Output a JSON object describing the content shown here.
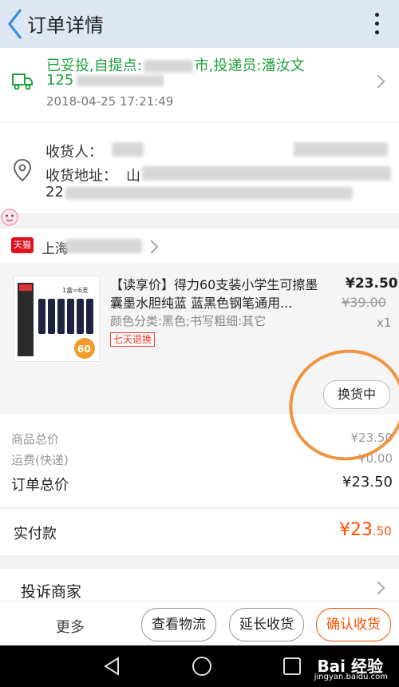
{
  "header": {
    "title": "订单详情"
  },
  "logistics": {
    "status_line1": "已妥投,自提点:",
    "status_line1_tail": "市,投递员:潘汝文",
    "status_line2": "125",
    "time": "2018-04-25 17:21:49"
  },
  "address": {
    "receiver_label": "收货人：",
    "address_label": "收货地址：",
    "address_start": "山",
    "postcode_start": "22"
  },
  "shop": {
    "badge": "天猫",
    "name_start": "上海"
  },
  "product": {
    "title": "【读享价】得力60支装小学生可擦墨囊墨水胆纯蓝 蓝黑色钢笔通用...",
    "spec": "颜色分类:黑色;书写粗细:其它",
    "return_tag": "七天退换",
    "price": "¥23.50",
    "original_price": "¥39.00",
    "quantity": "x1",
    "exchange_button": "换货中",
    "thumb_caption": "1盒=6支",
    "thumb_badge": "60",
    "thumb_count": "6支"
  },
  "totals": {
    "goods_label": "商品总价",
    "goods_value": "¥23.50",
    "shipping_label": "运费(快递)",
    "shipping_value": "¥0.00",
    "order_label": "订单总价",
    "order_value": "¥23.50"
  },
  "paid": {
    "label": "实付款",
    "currency": "¥",
    "int": "23",
    "dec": ".50"
  },
  "complain": {
    "label": "投诉商家"
  },
  "actions": {
    "more": "更多",
    "logistics": "查看物流",
    "extend": "延长收货",
    "confirm": "确认收货"
  },
  "watermark": {
    "brand": "Bai 经验",
    "url": "jingyan.baidu.com"
  },
  "colors": {
    "accent": "#ff5000",
    "status_green": "#1fa23b",
    "tmall_red": "#e0101f",
    "annotation": "#f08a2c"
  }
}
